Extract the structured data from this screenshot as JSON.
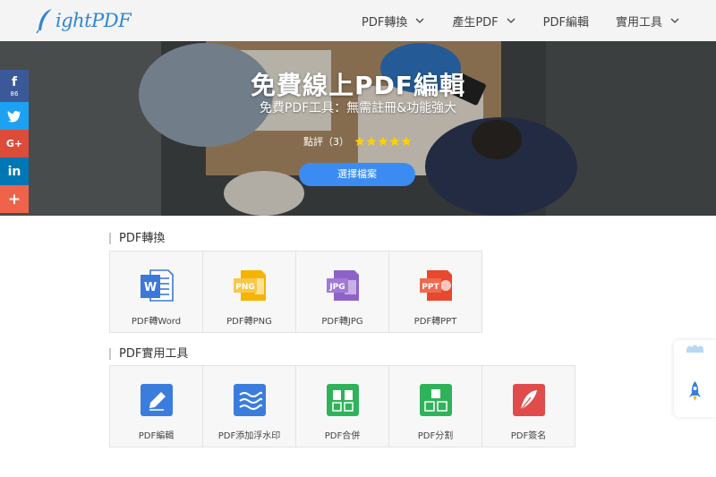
{
  "brand": {
    "logo_text": "ightPDF"
  },
  "nav": {
    "items": [
      {
        "label": "PDF轉換",
        "dropdown": true
      },
      {
        "label": "產生PDF",
        "dropdown": true
      },
      {
        "label": "PDF編輯",
        "dropdown": false
      },
      {
        "label": "實用工具",
        "dropdown": true
      }
    ]
  },
  "hero": {
    "title": "免費線上PDF編輯",
    "subtitle": "免費PDF工具：無需註冊&功能強大",
    "rating_label": "點評（3）",
    "stars": 5,
    "button_label": "選擇檔案"
  },
  "social": {
    "facebook_count": "86",
    "icons": [
      "facebook-icon",
      "twitter-icon",
      "google-plus-icon",
      "linkedin-icon",
      "share-plus-icon"
    ]
  },
  "sections": [
    {
      "title": "PDF轉換",
      "tools": [
        {
          "label": "PDF轉Word",
          "icon": "word-file-icon",
          "color": "#3c78d8"
        },
        {
          "label": "PDF轉PNG",
          "icon": "png-file-icon",
          "color": "#f4b400"
        },
        {
          "label": "PDF轉JPG",
          "icon": "jpg-file-icon",
          "color": "#8e63c7"
        },
        {
          "label": "PDF轉PPT",
          "icon": "ppt-file-icon",
          "color": "#e6492d"
        }
      ]
    },
    {
      "title": "PDF實用工具",
      "tools": [
        {
          "label": "PDF編輯",
          "icon": "pencil-edit-icon",
          "color": "#3b7ddd"
        },
        {
          "label": "PDF添加浮水印",
          "icon": "watermark-waves-icon",
          "color": "#3b7ddd"
        },
        {
          "label": "PDF合併",
          "icon": "merge-icon",
          "color": "#2fb35a"
        },
        {
          "label": "PDF分割",
          "icon": "split-icon",
          "color": "#2fb35a"
        },
        {
          "label": "PDF簽名",
          "icon": "feather-sign-icon",
          "color": "#e04c4c"
        }
      ]
    }
  ],
  "colors": {
    "accent": "#3b8cf2",
    "logo": "#2f86d6"
  }
}
